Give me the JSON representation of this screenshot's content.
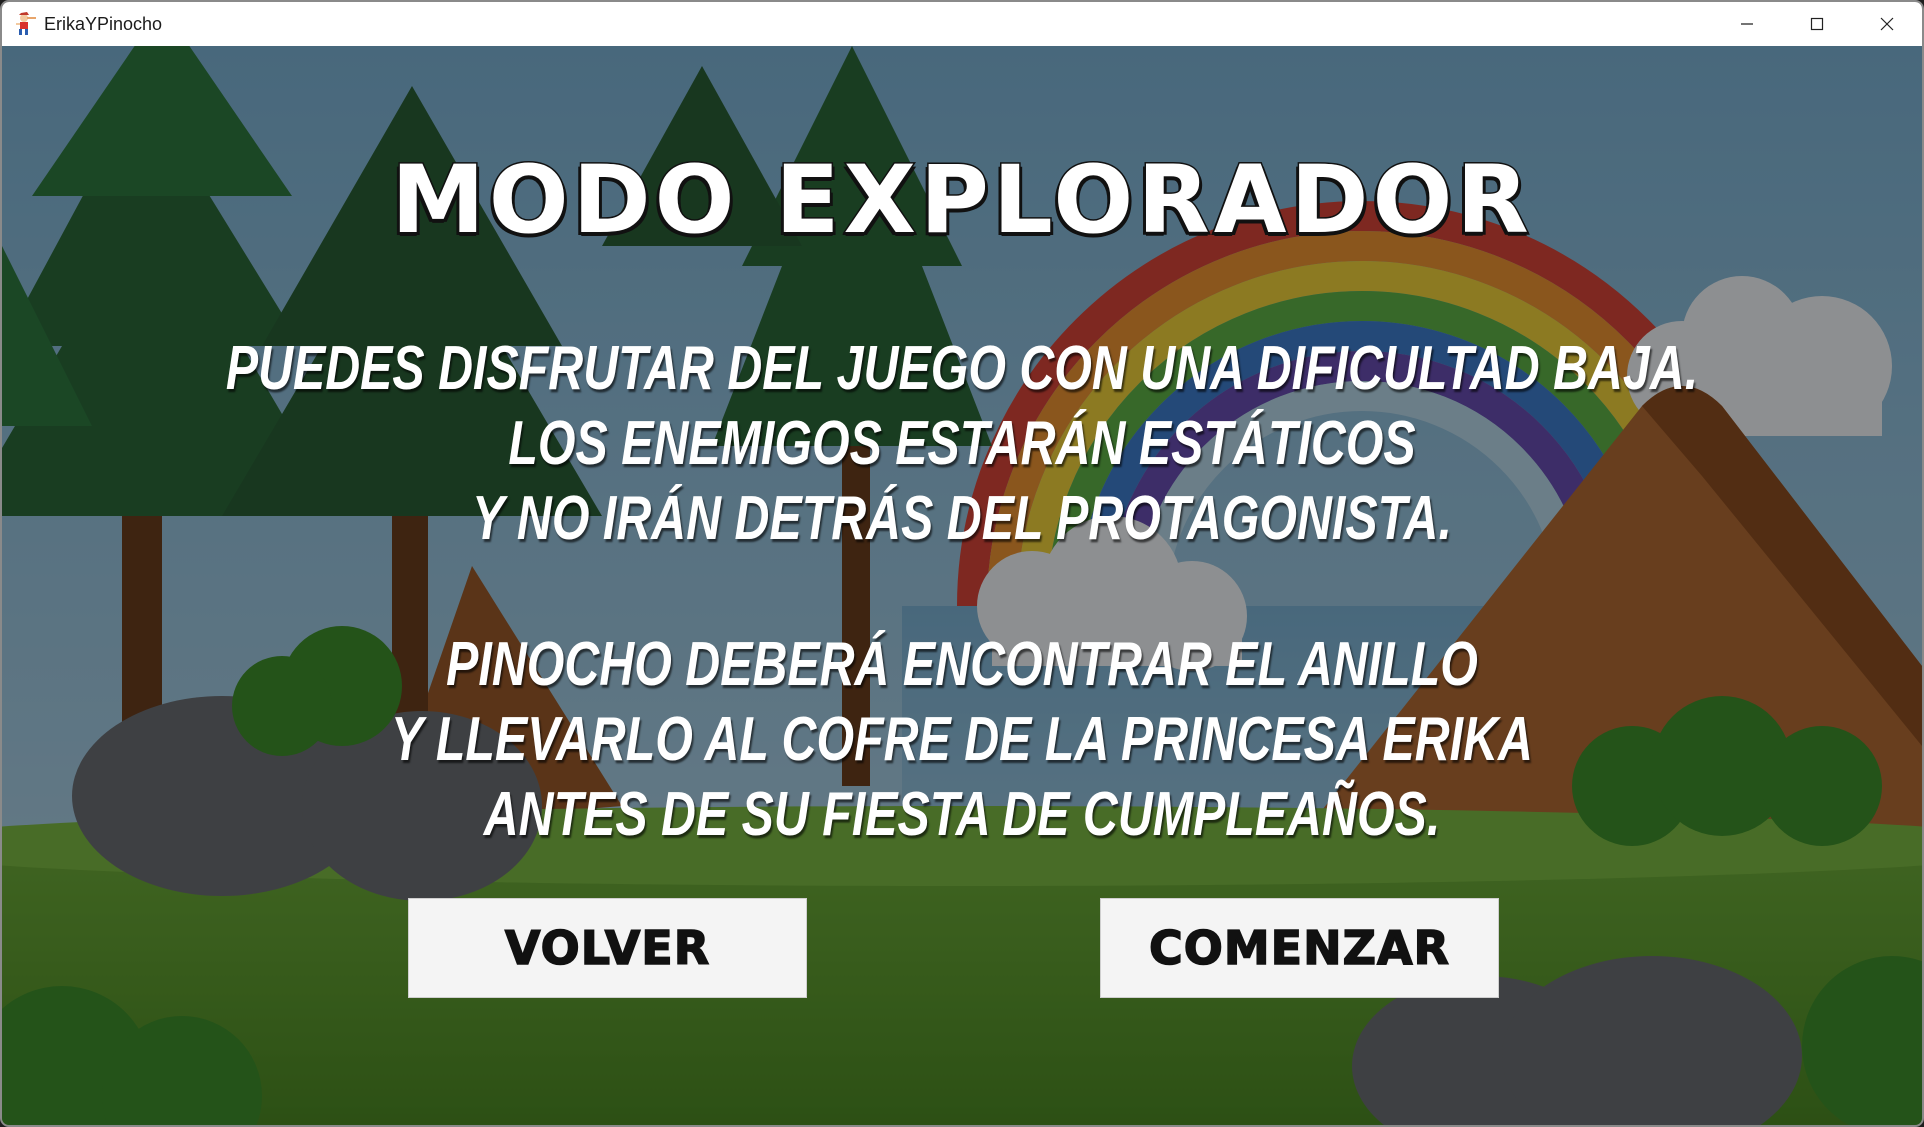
{
  "window": {
    "title": "ErikaYPinocho",
    "icon": "pinocchio-app-icon",
    "controls": [
      "minimize-icon",
      "maximize-icon",
      "close-icon"
    ]
  },
  "screen": {
    "title": "MODO EXPLORADOR",
    "description_block_1": [
      "PUEDES DISFRUTAR DEL JUEGO CON UNA DIFICULTAD BAJA.",
      "LOS ENEMIGOS ESTARÁN ESTÁTICOS",
      "Y NO IRÁN DETRÁS DEL PROTAGONISTA."
    ],
    "description_block_2": [
      "PINOCHO DEBERÁ ENCONTRAR EL ANILLO",
      "Y LLEVARLO AL COFRE DE LA PRINCESA ERIKA",
      "ANTES DE SU FIESTA DE CUMPLEAÑOS."
    ]
  },
  "buttons": {
    "back_label": "VOLVER",
    "start_label": "COMENZAR"
  },
  "colors": {
    "text": "#ffffff",
    "button_bg": "#f4f4f4",
    "button_text": "#111111",
    "overlay": "rgba(0,0,0,0.42)"
  }
}
